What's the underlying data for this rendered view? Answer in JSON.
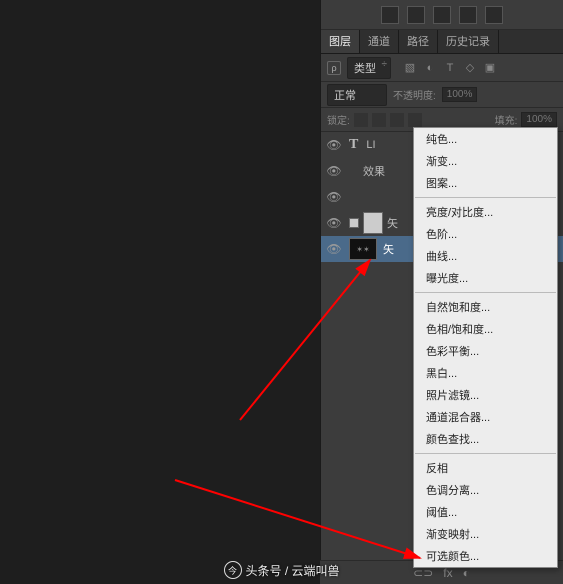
{
  "tabs": {
    "layers": "图层",
    "channels": "通道",
    "paths": "路径",
    "history": "历史记录"
  },
  "filter": {
    "kind": "类型"
  },
  "blend": {
    "mode": "正常",
    "opacity_label": "不透明度:",
    "opacity": "100%"
  },
  "lock": {
    "label": "锁定:",
    "fill_label": "填充:",
    "fill": "100%"
  },
  "layers": [
    {
      "name": "LI",
      "type": "text"
    },
    {
      "name": "效果",
      "type": "effect"
    },
    {
      "name": "矢",
      "type": "shape"
    },
    {
      "name": "矢",
      "type": "shape"
    }
  ],
  "context_menu": {
    "g1": [
      "纯色...",
      "渐变...",
      "图案..."
    ],
    "g2": [
      "亮度/对比度...",
      "色阶...",
      "曲线...",
      "曝光度..."
    ],
    "g3": [
      "自然饱和度...",
      "色相/饱和度...",
      "色彩平衡...",
      "黑白...",
      "照片滤镜...",
      "通道混合器...",
      "颜色查找..."
    ],
    "g4": [
      "反相",
      "色调分离...",
      "阈值...",
      "渐变映射...",
      "可选颜色..."
    ]
  },
  "watermark": "头条号 / 云端叫兽"
}
